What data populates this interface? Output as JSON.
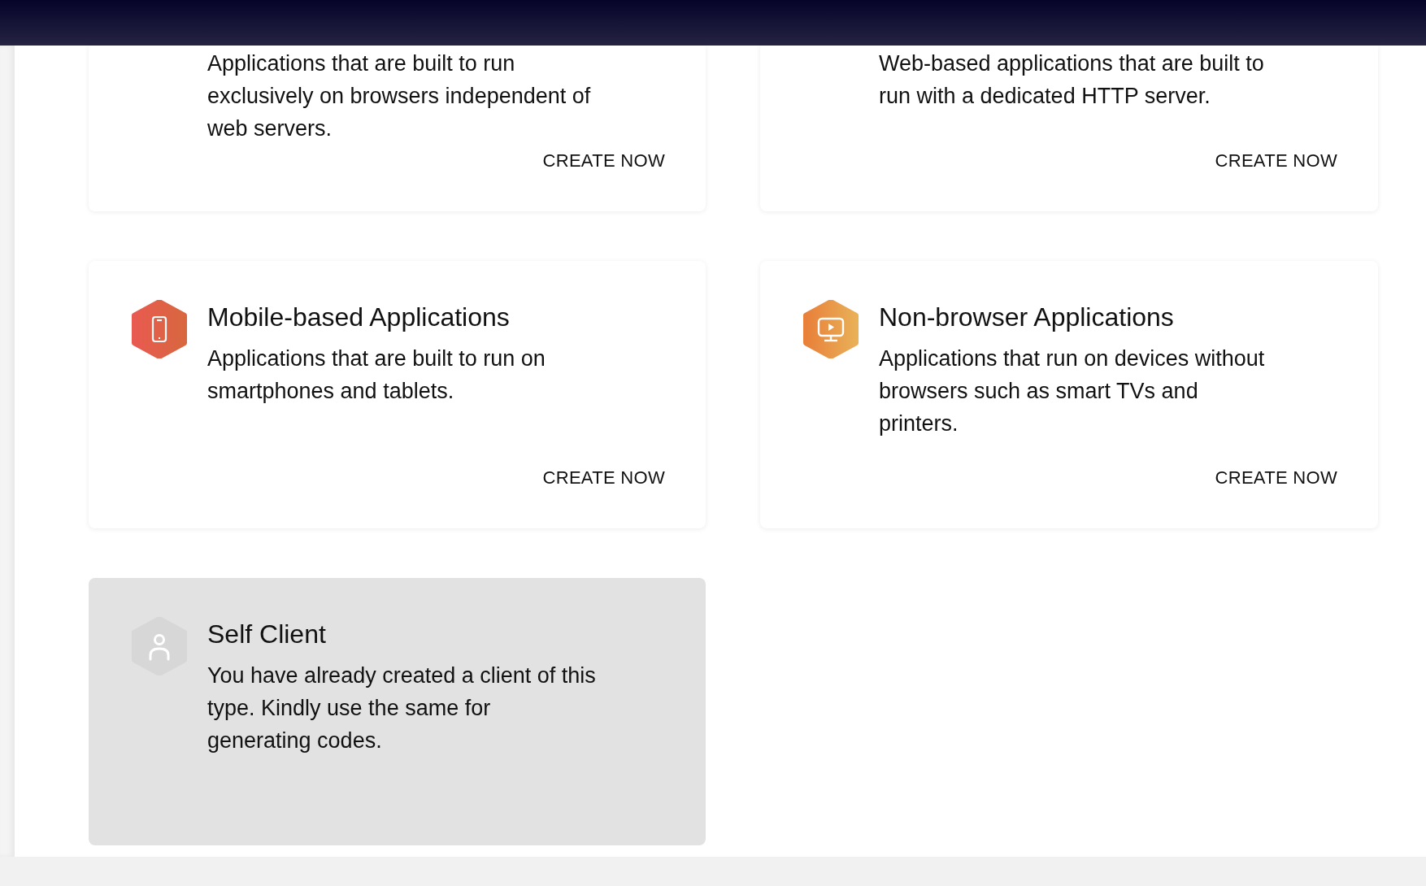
{
  "cards": [
    {
      "kind": "partial",
      "description": "Applications that are built to run exclusively on browsers independent of web servers.",
      "action": "CREATE NOW",
      "disabled": false
    },
    {
      "kind": "partial",
      "description": "Web-based applications that are built to run with a dedicated HTTP server.",
      "action": "CREATE NOW",
      "disabled": false
    },
    {
      "kind": "mobile",
      "title": "Mobile-based Applications",
      "description": "Applications that are built to run on smartphones and tablets.",
      "action": "CREATE NOW",
      "disabled": false
    },
    {
      "kind": "monitor",
      "title": "Non-browser Applications",
      "description": "Applications that run on devices without browsers such as smart TVs and printers.",
      "action": "CREATE NOW",
      "disabled": false
    },
    {
      "kind": "person",
      "title": "Self Client",
      "description": "You have already created a client of this type. Kindly use the same for generating codes.",
      "disabled": true
    }
  ]
}
